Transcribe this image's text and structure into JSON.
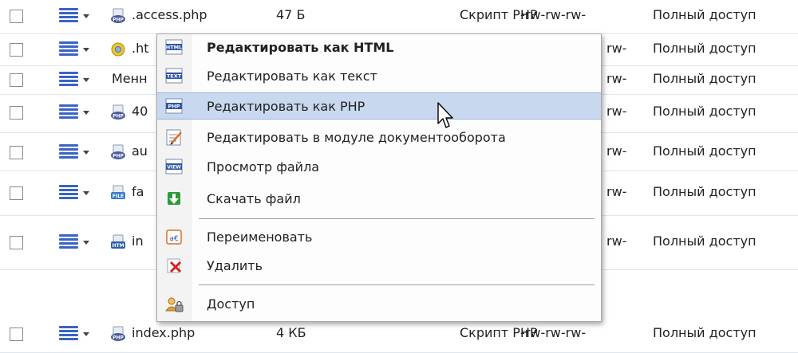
{
  "files": [
    {
      "icon": "php-file-icon",
      "name": ".access.php",
      "size": "47 Б",
      "type": "Скрипт PHP",
      "perm": "-rw-rw-rw-",
      "access": "Полный доступ"
    },
    {
      "icon": "config-file-icon",
      "name": ".ht",
      "size": "",
      "type": "",
      "perm": "rw-",
      "access": "Полный доступ"
    },
    {
      "icon": "",
      "name": "Менн",
      "size": "",
      "type": "",
      "perm": "rw-",
      "access": "Полный доступ"
    },
    {
      "icon": "php-file-icon",
      "name": "40",
      "size": "",
      "type": "",
      "perm": "rw-",
      "access": "Полный доступ"
    },
    {
      "icon": "php-file-icon",
      "name": "au",
      "size": "",
      "type": "",
      "perm": "rw-",
      "access": "Полный доступ"
    },
    {
      "icon": "file-icon",
      "name": "fa",
      "size": "",
      "type": "",
      "perm": "rw-",
      "access": "Полный доступ"
    },
    {
      "icon": "html-file-icon",
      "name": "in",
      "size": "",
      "type": "",
      "perm": "rw-",
      "access": "Полный доступ"
    },
    {
      "icon": "php-file-icon",
      "name": "index.php",
      "size": "4 КБ",
      "type": "Скрипт PHP",
      "perm": "-rw-rw-rw-",
      "access": "Полный доступ"
    }
  ],
  "context_menu": {
    "items": [
      {
        "icon": "html-icon",
        "label": "Редактировать как HTML"
      },
      {
        "icon": "text-icon",
        "label": "Редактировать как текст"
      },
      {
        "icon": "php-icon",
        "label": "Редактировать как PHP"
      },
      {
        "icon": "workflow-edit-icon",
        "label": "Редактировать в модуле документооборота"
      },
      {
        "icon": "view-icon",
        "label": "Просмотр файла"
      },
      {
        "icon": "download-icon",
        "label": "Скачать файл"
      },
      {
        "icon": "rename-icon",
        "label": "Переименовать"
      },
      {
        "icon": "delete-icon",
        "label": "Удалить"
      },
      {
        "icon": "access-icon",
        "label": "Доступ"
      }
    ],
    "icon_text": {
      "html": "HTML",
      "text": "TEXT",
      "php": "PHP",
      "view": "VIEW",
      "file": "FILE",
      "htm": "HTM",
      "rename": "a€"
    }
  },
  "colors": {
    "highlight": "#c8d9ef",
    "menu_icon_blue": "#3a63c6"
  }
}
